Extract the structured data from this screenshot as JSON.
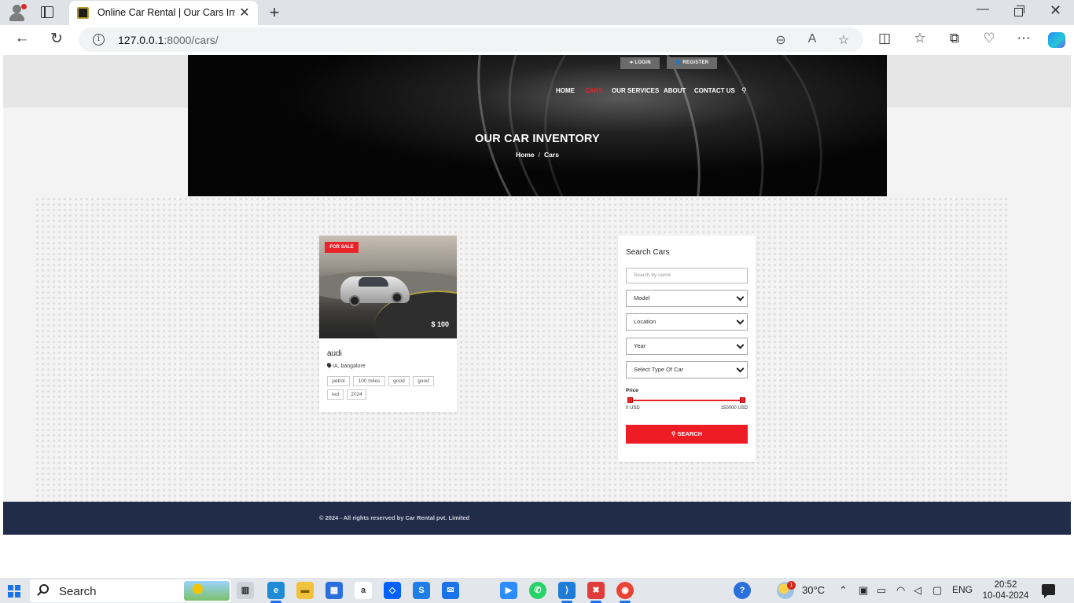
{
  "browser": {
    "tab_title": "Online Car Rental | Our Cars Inve",
    "url_host": "127.0.0.1",
    "url_rest": ":8000/cars/",
    "new_tab_label": "+",
    "tab_close_label": "✕"
  },
  "header": {
    "login_label": "LOGIN",
    "register_label": "REGISTER",
    "menu": [
      {
        "label": "HOME"
      },
      {
        "label": "CARS"
      },
      {
        "label": "OUR SERVICES"
      },
      {
        "label": "ABOUT"
      },
      {
        "label": "CONTACT US"
      }
    ],
    "title": "OUR CAR INVENTORY",
    "breadcrumb": {
      "home": "Home",
      "sep": "/",
      "current": "Cars"
    }
  },
  "car": {
    "badge": "FOR SALE",
    "price": "$ 100",
    "name": "audi",
    "location": "IA, bangalore",
    "tags": [
      "petrol",
      "100 miles",
      "good",
      "good",
      "red",
      "2024"
    ]
  },
  "search": {
    "title": "Search Cars",
    "name_placeholder": "Search by name",
    "selects": [
      "Model",
      "Location",
      "Year",
      "Select Type Of Car"
    ],
    "price_label": "Price",
    "price_min": "0 USD",
    "price_max": "150000 USD",
    "price_range_fraction": [
      0,
      1
    ],
    "button_label": "SEARCH"
  },
  "footer": {
    "text": "© 2024 - All rights reserved by Car Rental pvt. Limited"
  },
  "taskbar": {
    "search_label": "Search",
    "weather_badge": "1",
    "temperature": "30°C",
    "language": "ENG",
    "time": "20:52",
    "date": "10-04-2024"
  },
  "colors": {
    "accent_red": "#ee1c25",
    "footer_navy": "#212b4a",
    "hero_black": "#050505"
  }
}
